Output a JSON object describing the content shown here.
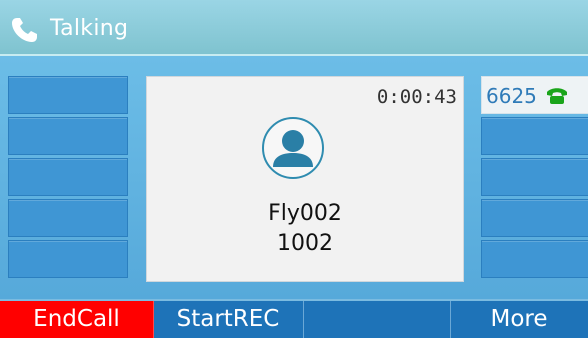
{
  "header": {
    "title": "Talking",
    "icon": "phone-icon"
  },
  "call": {
    "timer": "0:00:43",
    "contact_name": "Fly002",
    "contact_number": "1002",
    "avatar_icon": "person-avatar-icon"
  },
  "lines": {
    "active_line_label": "6625",
    "active_line_icon": "green-handset-icon"
  },
  "softkeys": [
    {
      "label": "EndCall",
      "color": "#ff0000"
    },
    {
      "label": "StartREC"
    },
    {
      "label": ""
    },
    {
      "label": "More"
    }
  ],
  "colors": {
    "accent": "#1e73b8",
    "end_call": "#ff0000",
    "title_bar": "#8ccadb",
    "line_icon": "#1aa51a"
  }
}
